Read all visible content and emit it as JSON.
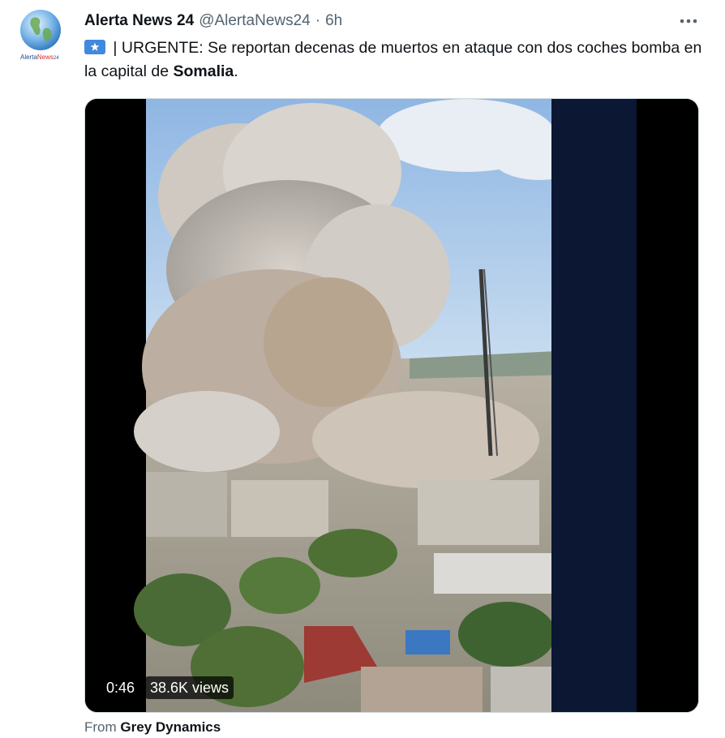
{
  "tweet": {
    "author_name": "Alerta News 24",
    "handle": "@AlertaNews24",
    "separator": "·",
    "time": "6h",
    "avatar_text_a": "Alerta",
    "avatar_text_b": "News",
    "avatar_text_c": "24",
    "text_prefix": " | URGENTE: Se reportan decenas de muertos en ataque con dos coches bomba en la capital de ",
    "text_bold": "Somalia",
    "text_suffix": ".",
    "flag_icon": "somalia-flag-icon"
  },
  "video": {
    "duration": "0:46",
    "views": "38.6K views"
  },
  "source": {
    "prefix": "From",
    "name": "Grey Dynamics"
  },
  "colors": {
    "flag_blue": "#4189dd",
    "secondary_text": "#536471",
    "primary_text": "#0f1419"
  }
}
